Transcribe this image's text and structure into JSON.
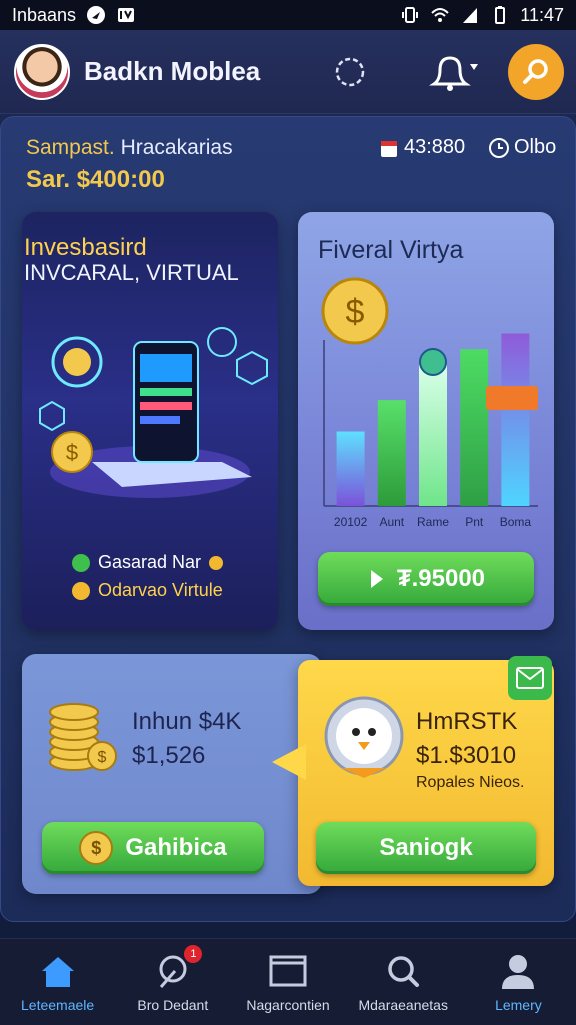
{
  "status_bar": {
    "carrier": "Inbaans",
    "time": "11:47"
  },
  "header": {
    "title": "Badkn Moblea"
  },
  "balance": {
    "label_key": "Sampast.",
    "label_value": "Hracakarias",
    "line2": "Sar. $400:00",
    "stat_a": "43:880",
    "stat_b": "Olbo"
  },
  "invest_card": {
    "title": "Invesbasird",
    "subtitle": "INVCARAL, VIRTUAL",
    "bullets": [
      "Gasarad Nar",
      "Odarvao Virtule"
    ]
  },
  "chart_card": {
    "title": "Fiveral Virtya",
    "button_label": "₮.95000"
  },
  "chart_data": {
    "type": "bar",
    "categories": [
      "20102",
      "Aunt",
      "Rame",
      "Pnt",
      "Boma"
    ],
    "values": [
      38,
      54,
      72,
      80,
      88
    ],
    "ylim": [
      0,
      100
    ],
    "grid": false
  },
  "income_card": {
    "line1": "Inhun $4K",
    "line2": "$1,526",
    "button_label": "Gahibica"
  },
  "reward_card": {
    "line1": "HmRSTK",
    "line2": "$1.$3010",
    "line3": "Ropales Nieos.",
    "button_label": "Saniogk"
  },
  "nav": {
    "items": [
      {
        "label": "Leteemaele",
        "icon": "home-icon"
      },
      {
        "label": "Bro Dedant",
        "icon": "analytics-icon",
        "badge": "1"
      },
      {
        "label": "Nagarcontien",
        "icon": "wallet-icon"
      },
      {
        "label": "Mdaraeanetas",
        "icon": "search-icon"
      },
      {
        "label": "Lemery",
        "icon": "profile-icon"
      }
    ]
  },
  "colors": {
    "accent_gold": "#f2c94c",
    "green_button": "#34a83b",
    "active_nav": "#5fb6ff"
  }
}
